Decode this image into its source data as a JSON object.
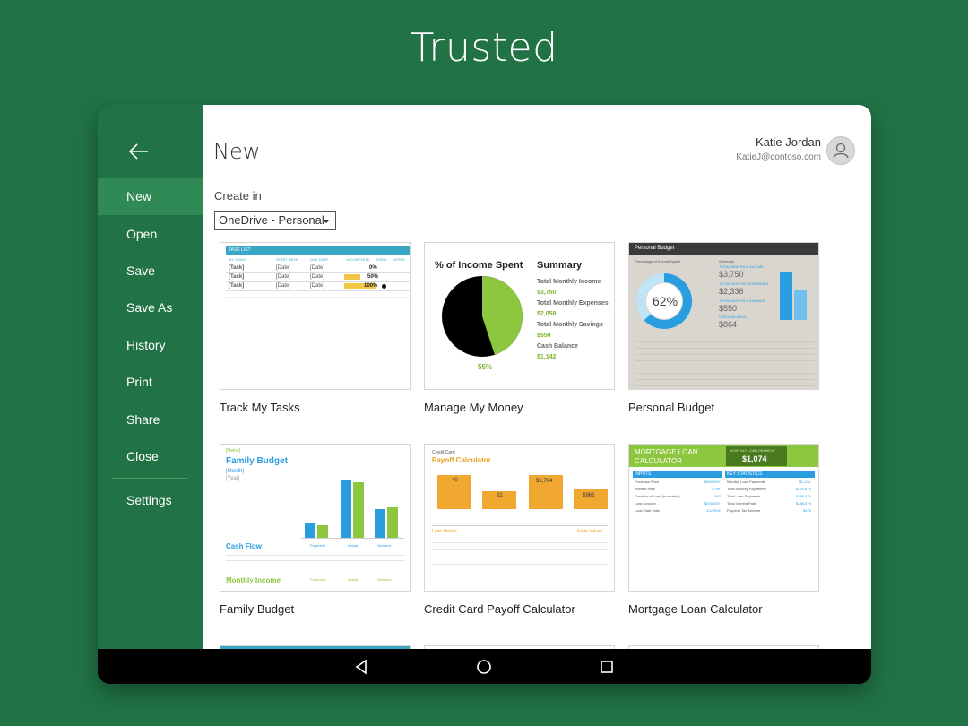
{
  "banner": {
    "title": "Trusted"
  },
  "sidebar": {
    "items": [
      {
        "label": "New",
        "active": true
      },
      {
        "label": "Open"
      },
      {
        "label": "Save"
      },
      {
        "label": "Save As"
      },
      {
        "label": "History"
      },
      {
        "label": "Print"
      },
      {
        "label": "Share"
      },
      {
        "label": "Close"
      }
    ],
    "settings_label": "Settings"
  },
  "header": {
    "title": "New",
    "user_name": "Katie Jordan",
    "user_email": "KatieJ@contoso.com"
  },
  "create_in": {
    "label": "Create in",
    "selected": "OneDrive - Personal"
  },
  "templates": [
    {
      "name": "Track My Tasks"
    },
    {
      "name": "Manage My Money"
    },
    {
      "name": "Personal Budget"
    },
    {
      "name": "Family Budget"
    },
    {
      "name": "Credit Card Payoff Calculator"
    },
    {
      "name": "Mortgage Loan Calculator"
    }
  ],
  "thumbs": {
    "tasks": {
      "header": "TASK LIST",
      "col1": "MY TASKS",
      "col2": "START DATE",
      "col3": "DUE DATE",
      "col4": "% COMPLETE",
      "col5": "DONE",
      "col6": "NOTES",
      "task": "[Task]",
      "date": "[Date]",
      "p1": "0%",
      "p2": "50%",
      "p3": "100%"
    },
    "money": {
      "chart_title": "% of Income Spent",
      "summary": "Summary",
      "l1": "Total Monthly Income",
      "v1": "$3,750",
      "l2": "Total Monthly Expenses",
      "v2": "$2,058",
      "l3": "Total Monthly Savings",
      "v3": "$550",
      "l4": "Cash Balance",
      "v4": "$1,142",
      "pct": "55%"
    },
    "personal": {
      "header": "Personal Budget",
      "sub": "Percentage of Income Spent",
      "pct": "62%",
      "summary": "Summary",
      "l1": "TOTAL MONTHLY INCOME",
      "v1": "$3,750",
      "l2": "TOTAL MONTHLY EXPENSES",
      "v2": "$2,336",
      "l3": "TOTAL MONTHLY SAVINGS",
      "v3": "$550",
      "l4": "CASH BALANCE",
      "v4": "$864"
    },
    "family": {
      "name": "[Name]",
      "title": "Family Budget",
      "month": "[Month]",
      "year": "[Year]",
      "cash_flow": "Cash Flow",
      "monthly_income": "Monthly Income",
      "projected": "Projected",
      "actual": "Actual",
      "variance": "Variance"
    },
    "credit": {
      "small": "Credit Card",
      "title": "Payoff Calculator",
      "b1": "40",
      "b2": "22",
      "b3": "$1,784",
      "b4": "$966",
      "loan_details": "Loan Details",
      "enter_values": "Enter Values"
    },
    "mortgage": {
      "title1": "MORTGAGE LOAN",
      "title2": "CALCULATOR",
      "payment_label": "MONTHLY LOAN PAYMENT",
      "payment": "$1,074",
      "inputs": "INPUTS",
      "stats": "KEY STATISTICS",
      "rows_left": [
        [
          "Purchase Price",
          "$300,000"
        ],
        [
          "Interest Rate",
          "5.0%"
        ],
        [
          "Duration of Loan (in months)",
          "360"
        ],
        [
          "Loan Amount",
          "$200,000"
        ],
        [
          "Loan Start Date",
          "1/1/2015"
        ]
      ],
      "rows_right": [
        [
          "Monthly Loan Payments",
          "$1,074"
        ],
        [
          "Total Monthly Payments*",
          "$420,679"
        ],
        [
          "Total Loan Payments",
          "$386,679"
        ],
        [
          "Total Interest Paid",
          "$185,679"
        ],
        [
          "Property Tax Amount",
          "$475"
        ]
      ]
    }
  },
  "colors": {
    "accent": "#217346",
    "sidebar_active": "#2f8a55"
  }
}
